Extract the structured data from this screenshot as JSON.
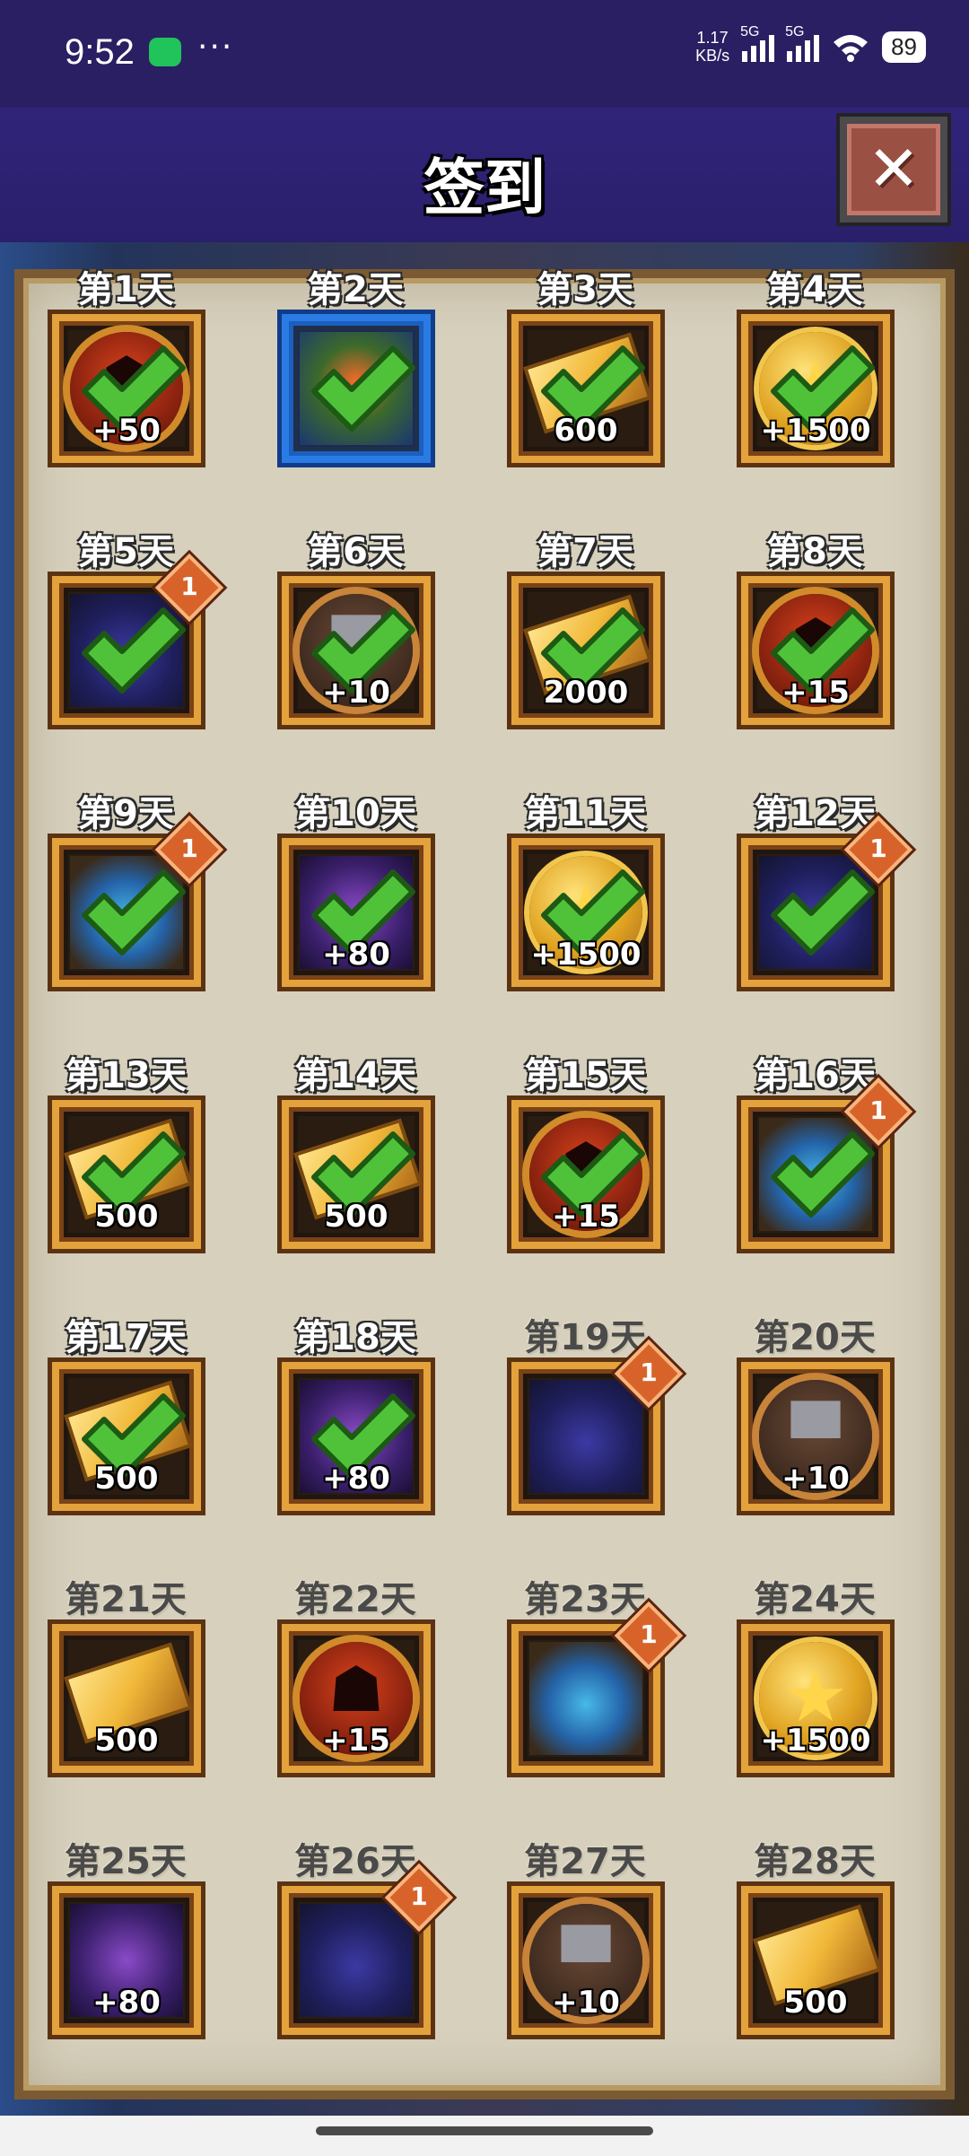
{
  "status_bar": {
    "time": "9:52",
    "dots": "···",
    "net_speed_value": "1.17",
    "net_speed_unit": "KB/s",
    "signal1_label": "5G",
    "signal2_label": "5G",
    "battery": "89"
  },
  "header": {
    "title": "签到",
    "close_icon": "close-icon"
  },
  "days": [
    {
      "label": "第1天",
      "item": "red-demon-badge",
      "amount": "+50",
      "claimed": true,
      "badge": ""
    },
    {
      "label": "第2天",
      "item": "hero-card",
      "amount": "",
      "claimed": true,
      "badge": "",
      "frame": "blue"
    },
    {
      "label": "第3天",
      "item": "gold-bar",
      "amount": "600",
      "claimed": true,
      "badge": ""
    },
    {
      "label": "第4天",
      "item": "gold-coin",
      "amount": "+1500",
      "claimed": true,
      "badge": ""
    },
    {
      "label": "第5天",
      "item": "demon-figure",
      "amount": "",
      "claimed": true,
      "badge": "1"
    },
    {
      "label": "第6天",
      "item": "anvil-badge",
      "amount": "+10",
      "claimed": true,
      "badge": ""
    },
    {
      "label": "第7天",
      "item": "gold-bar",
      "amount": "2000",
      "claimed": true,
      "badge": ""
    },
    {
      "label": "第8天",
      "item": "red-demon-badge",
      "amount": "+15",
      "claimed": true,
      "badge": ""
    },
    {
      "label": "第9天",
      "item": "gauntlet",
      "amount": "",
      "claimed": true,
      "badge": "1"
    },
    {
      "label": "第10天",
      "item": "galaxy-gem",
      "amount": "+80",
      "claimed": true,
      "badge": ""
    },
    {
      "label": "第11天",
      "item": "gold-coin",
      "amount": "+1500",
      "claimed": true,
      "badge": ""
    },
    {
      "label": "第12天",
      "item": "demon-figure",
      "amount": "",
      "claimed": true,
      "badge": "1"
    },
    {
      "label": "第13天",
      "item": "gold-bar",
      "amount": "500",
      "claimed": true,
      "badge": ""
    },
    {
      "label": "第14天",
      "item": "gold-bar",
      "amount": "500",
      "claimed": true,
      "badge": ""
    },
    {
      "label": "第15天",
      "item": "red-demon-badge",
      "amount": "+15",
      "claimed": true,
      "badge": ""
    },
    {
      "label": "第16天",
      "item": "gauntlet",
      "amount": "",
      "claimed": true,
      "badge": "1"
    },
    {
      "label": "第17天",
      "item": "gold-bar",
      "amount": "500",
      "claimed": true,
      "badge": ""
    },
    {
      "label": "第18天",
      "item": "galaxy-gem",
      "amount": "+80",
      "claimed": true,
      "badge": ""
    },
    {
      "label": "第19天",
      "item": "demon-figure",
      "amount": "",
      "claimed": false,
      "badge": "1"
    },
    {
      "label": "第20天",
      "item": "anvil-badge",
      "amount": "+10",
      "claimed": false,
      "badge": ""
    },
    {
      "label": "第21天",
      "item": "gold-bar",
      "amount": "500",
      "claimed": false,
      "badge": ""
    },
    {
      "label": "第22天",
      "item": "red-demon-badge",
      "amount": "+15",
      "claimed": false,
      "badge": ""
    },
    {
      "label": "第23天",
      "item": "gauntlet",
      "amount": "",
      "claimed": false,
      "badge": "1"
    },
    {
      "label": "第24天",
      "item": "gold-coin",
      "amount": "+1500",
      "claimed": false,
      "badge": ""
    },
    {
      "label": "第25天",
      "item": "galaxy-gem",
      "amount": "+80",
      "claimed": false,
      "badge": ""
    },
    {
      "label": "第26天",
      "item": "demon-figure",
      "amount": "",
      "claimed": false,
      "badge": "1"
    },
    {
      "label": "第27天",
      "item": "anvil-badge",
      "amount": "+10",
      "claimed": false,
      "badge": ""
    },
    {
      "label": "第28天",
      "item": "gold-bar",
      "amount": "500",
      "claimed": false,
      "badge": ""
    }
  ],
  "colors": {
    "header_bg": "#2a1f63",
    "frame_gold": "#e3a23b",
    "frame_blue": "#2a7be4",
    "check_green": "#4fc23a",
    "badge_orange": "#d8632a"
  }
}
